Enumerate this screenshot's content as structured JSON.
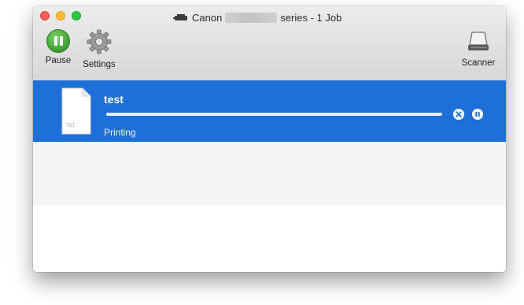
{
  "window": {
    "title_prefix": "Canon",
    "title_suffix": "series - 1 Job"
  },
  "toolbar": {
    "pause_label": "Pause",
    "settings_label": "Settings",
    "scanner_label": "Scanner"
  },
  "job": {
    "name": "test",
    "status": "Printing",
    "progress": 1.0,
    "icon": "document-icon"
  },
  "colors": {
    "selection": "#1f6fd8",
    "pause_green": "#3c9d2f"
  }
}
